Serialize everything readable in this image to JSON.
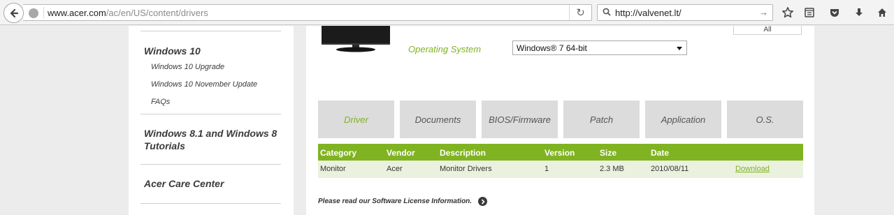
{
  "browser": {
    "url_domain": "www.acer.com",
    "url_path": "/ac/en/US/content/drivers",
    "reload_glyph": "↻",
    "search_value": "http://valvenet.lt/",
    "search_go_glyph": "→",
    "icons": [
      "back-icon",
      "globe-icon",
      "reload-icon",
      "search-icon",
      "bookmark-star-icon",
      "reading-list-icon",
      "pocket-icon",
      "download-icon",
      "home-icon"
    ]
  },
  "sidebar": {
    "sections": [
      {
        "title": "Windows 10",
        "items": [
          "Windows 10 Upgrade",
          "Windows 10 November Update",
          "FAQs"
        ]
      },
      {
        "title": "Windows 8.1 and Windows 8 Tutorials",
        "items": []
      },
      {
        "title": "Acer Care Center",
        "items": []
      }
    ]
  },
  "product": {
    "all_label": "All",
    "os_label": "Operating System",
    "os_selected": "Windows® 7 64-bit"
  },
  "tabs": [
    {
      "label": "Driver",
      "active": true
    },
    {
      "label": "Documents",
      "active": false
    },
    {
      "label": "BIOS/Firmware",
      "active": false
    },
    {
      "label": "Patch",
      "active": false
    },
    {
      "label": "Application",
      "active": false
    },
    {
      "label": "O.S.",
      "active": false
    }
  ],
  "table": {
    "headers": [
      "Category",
      "Vendor",
      "Description",
      "Version",
      "Size",
      "Date"
    ],
    "rows": [
      {
        "category": "Monitor",
        "vendor": "Acer",
        "description": "Monitor Drivers",
        "version": "1",
        "size": "2.3 MB",
        "date": "2010/08/11",
        "action": "Download"
      }
    ]
  },
  "license_text": "Please read our Software License Information.",
  "colors": {
    "accent": "#80b321",
    "row_bg": "#eaf1de",
    "tab_bg": "#dcdcdc"
  }
}
